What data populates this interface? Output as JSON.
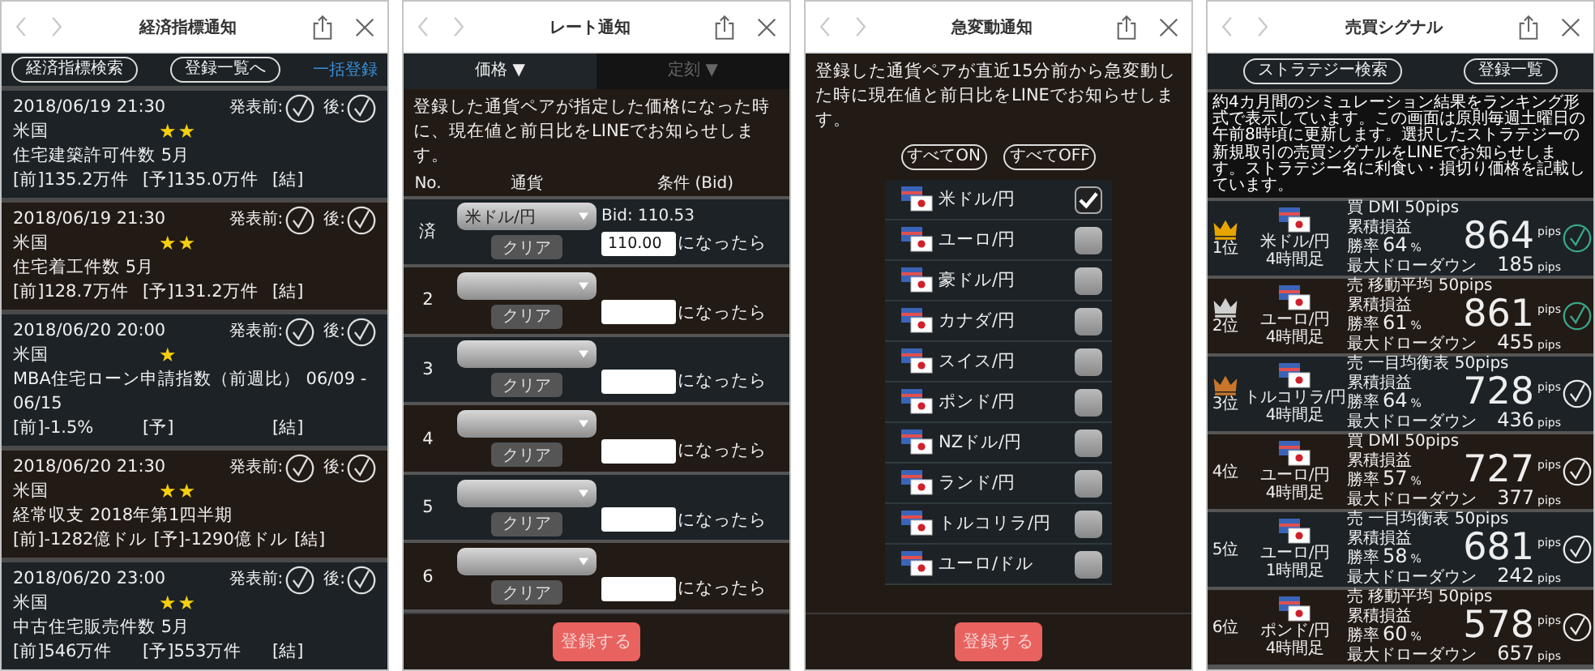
{
  "screens": [
    {
      "kind": "indicators",
      "title": "経済指標通知",
      "toolbar": [
        {
          "label": "経済指標検索",
          "kind": "pill"
        },
        {
          "label": "登録一覧へ",
          "kind": "pill"
        },
        {
          "label": "一括登録",
          "kind": "link"
        }
      ],
      "events": [
        {
          "date": "2018/06/19 21:30",
          "country": "米国",
          "importance": "★★",
          "name": "住宅建築許可件数 5月",
          "previous": "[前]135.2万件",
          "forecast": "[予]135.0万件",
          "result": "[結]",
          "before_label": "発表前:",
          "after_label": "後:"
        },
        {
          "date": "2018/06/19 21:30",
          "country": "米国",
          "importance": "★★",
          "name": "住宅着工件数 5月",
          "previous": "[前]128.7万件",
          "forecast": "[予]131.2万件",
          "result": "[結]",
          "before_label": "発表前:",
          "after_label": "後:"
        },
        {
          "date": "2018/06/20 20:00",
          "country": "米国",
          "importance": "★",
          "name": "MBA住宅ローン申請指数（前週比） 06/09 - 06/15",
          "previous": "[前]-1.5%",
          "forecast": "[予]",
          "result": "[結]",
          "before_label": "発表前:",
          "after_label": "後:"
        },
        {
          "date": "2018/06/20 21:30",
          "country": "米国",
          "importance": "★★",
          "name": "経常収支 2018年第1四半期",
          "previous": "[前]-1282億ドル",
          "forecast": "[予]-1290億ドル",
          "result": "[結]",
          "before_label": "発表前:",
          "after_label": "後:"
        },
        {
          "date": "2018/06/20 23:00",
          "country": "米国",
          "importance": "★★",
          "name": "中古住宅販売件数 5月",
          "previous": "[前]546万件",
          "forecast": "[予]553万件",
          "result": "[結]",
          "before_label": "発表前:",
          "after_label": "後:"
        }
      ]
    },
    {
      "kind": "rate",
      "title": "レート通知",
      "tabs": [
        {
          "label": "価格 ▼",
          "selected": true
        },
        {
          "label": "定刻 ▼",
          "selected": false
        }
      ],
      "description": "登録した通貨ペアが指定した価格になった時に、現在値と前日比をLINEでお知らせします。",
      "columns": [
        "No.",
        "通貨",
        "条件 (Bid)"
      ],
      "rows": [
        {
          "no": "済",
          "currency": "米ドル/円",
          "clear": "クリア",
          "bid": "Bid: 110.53",
          "price": "110.00",
          "suffix": "になったら"
        },
        {
          "no": "2",
          "clear": "クリア",
          "suffix": "になったら"
        },
        {
          "no": "3",
          "clear": "クリア",
          "suffix": "になったら"
        },
        {
          "no": "4",
          "clear": "クリア",
          "suffix": "になったら"
        },
        {
          "no": "5",
          "clear": "クリア",
          "suffix": "になったら"
        },
        {
          "no": "6",
          "clear": "クリア",
          "suffix": "になったら"
        }
      ],
      "submit": "登録する"
    },
    {
      "kind": "surge",
      "title": "急変動通知",
      "description": "登録した通貨ペアが直近15分前から急変動した時に現在値と前日比をLINEでお知らせします。",
      "toggles": [
        "すべてON",
        "すべてOFF"
      ],
      "pairs": [
        {
          "name": "米ドル/円",
          "checked": true
        },
        {
          "name": "ユーロ/円",
          "checked": false
        },
        {
          "name": "豪ドル/円",
          "checked": false
        },
        {
          "name": "カナダ/円",
          "checked": false
        },
        {
          "name": "スイス/円",
          "checked": false
        },
        {
          "name": "ポンド/円",
          "checked": false
        },
        {
          "name": "NZドル/円",
          "checked": false
        },
        {
          "name": "ランド/円",
          "checked": false
        },
        {
          "name": "トルコリラ/円",
          "checked": false
        },
        {
          "name": "ユーロ/ドル",
          "checked": false
        }
      ],
      "submit": "登録する"
    },
    {
      "kind": "signals",
      "title": "売買シグナル",
      "toolbar": [
        {
          "label": "ストラテジー検索",
          "kind": "pill"
        },
        {
          "label": "登録一覧",
          "kind": "pill"
        }
      ],
      "description": "約4カ月間のシミュレーション結果をランキング形式で表示しています。この画面は原則毎週土曜日の午前8時頃に更新します。選択したストラテジーの新規取引の売買シグナルをLINEでお知らせします。ストラテジー名に利食い・損切り価格を記載しています。",
      "signals": [
        {
          "color": "#e8a400",
          "rank": "1位",
          "pair": "米ドル/円",
          "timeframe": "4時間足",
          "strategy": "買 DMI 50pips",
          "profit_label": "累積損益",
          "profit": "864",
          "profit_unit": "pips",
          "win_label": "勝率",
          "win_rate": "64",
          "win_unit": "%",
          "drawdown_label": "最大ドローダウン",
          "drawdown": "185",
          "drawdown_unit": "pips",
          "checked": true
        },
        {
          "color": "#d0d0d0",
          "rank": "2位",
          "pair": "ユーロ/円",
          "timeframe": "4時間足",
          "strategy": "売 移動平均 50pips",
          "profit_label": "累積損益",
          "profit": "861",
          "profit_unit": "pips",
          "win_label": "勝率",
          "win_rate": "61",
          "win_unit": "%",
          "drawdown_label": "最大ドローダウン",
          "drawdown": "455",
          "drawdown_unit": "pips",
          "checked": true
        },
        {
          "color": "#c9762a",
          "rank": "3位",
          "pair": "トルコリラ/円",
          "timeframe": "4時間足",
          "strategy": "売 一目均衡表 50pips",
          "profit_label": "累積損益",
          "profit": "728",
          "profit_unit": "pips",
          "win_label": "勝率",
          "win_rate": "64",
          "win_unit": "%",
          "drawdown_label": "最大ドローダウン",
          "drawdown": "436",
          "drawdown_unit": "pips",
          "checked": false
        },
        {
          "rank": "4位",
          "pair": "ユーロ/円",
          "timeframe": "4時間足",
          "strategy": "買 DMI 50pips",
          "profit_label": "累積損益",
          "profit": "727",
          "profit_unit": "pips",
          "win_label": "勝率",
          "win_rate": "57",
          "win_unit": "%",
          "drawdown_label": "最大ドローダウン",
          "drawdown": "377",
          "drawdown_unit": "pips",
          "checked": false
        },
        {
          "rank": "5位",
          "pair": "ユーロ/円",
          "timeframe": "1時間足",
          "strategy": "売 一目均衡表 50pips",
          "profit_label": "累積損益",
          "profit": "681",
          "profit_unit": "pips",
          "win_label": "勝率",
          "win_rate": "58",
          "win_unit": "%",
          "drawdown_label": "最大ドローダウン",
          "drawdown": "242",
          "drawdown_unit": "pips",
          "checked": false
        },
        {
          "rank": "6位",
          "pair": "ポンド/円",
          "timeframe": "4時間足",
          "strategy": "売 移動平均 50pips",
          "profit_label": "累積損益",
          "profit": "578",
          "profit_unit": "pips",
          "win_label": "勝率",
          "win_rate": "60",
          "win_unit": "%",
          "drawdown_label": "最大ドローダウン",
          "drawdown": "657",
          "drawdown_unit": "pips",
          "checked": false
        }
      ]
    }
  ]
}
